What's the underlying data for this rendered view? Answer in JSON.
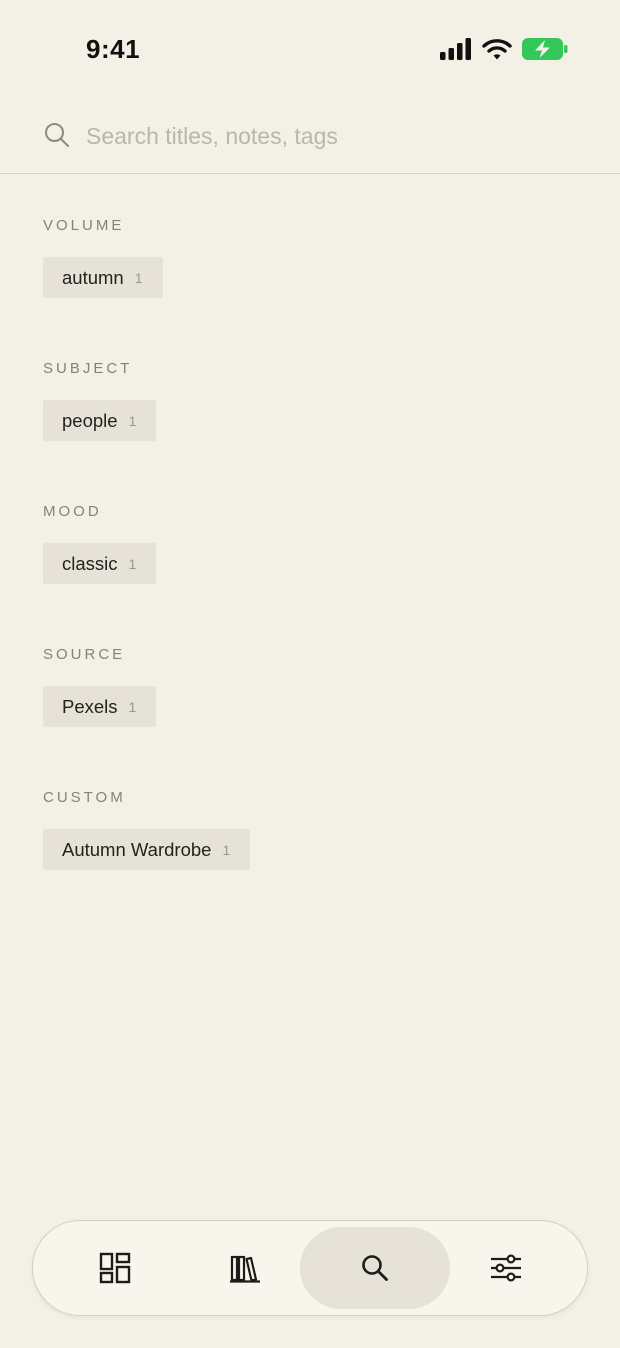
{
  "status_bar": {
    "time": "9:41",
    "icons": [
      "cellular-signal-icon",
      "wifi-icon",
      "battery-charging-icon"
    ],
    "battery_color": "#34c759"
  },
  "search": {
    "placeholder": "Search titles, notes, tags",
    "value": ""
  },
  "groups": [
    {
      "title": "VOLUME",
      "tags": [
        {
          "label": "autumn",
          "count": "1"
        }
      ]
    },
    {
      "title": "SUBJECT",
      "tags": [
        {
          "label": "people",
          "count": "1"
        }
      ]
    },
    {
      "title": "MOOD",
      "tags": [
        {
          "label": "classic",
          "count": "1"
        }
      ]
    },
    {
      "title": "SOURCE",
      "tags": [
        {
          "label": "Pexels",
          "count": "1"
        }
      ]
    },
    {
      "title": "CUSTOM",
      "tags": [
        {
          "label": "Autumn Wardrobe",
          "count": "1"
        }
      ]
    }
  ],
  "tab_bar": {
    "tabs": [
      {
        "id": "grid",
        "icon": "grid-icon",
        "active": false
      },
      {
        "id": "library",
        "icon": "books-icon",
        "active": false
      },
      {
        "id": "search",
        "icon": "search-icon",
        "active": true
      },
      {
        "id": "settings",
        "icon": "sliders-icon",
        "active": false
      }
    ]
  },
  "colors": {
    "background": "#f3f0e6",
    "tag_background": "#e6e2d7",
    "tab_active": "#e6e2d7"
  }
}
